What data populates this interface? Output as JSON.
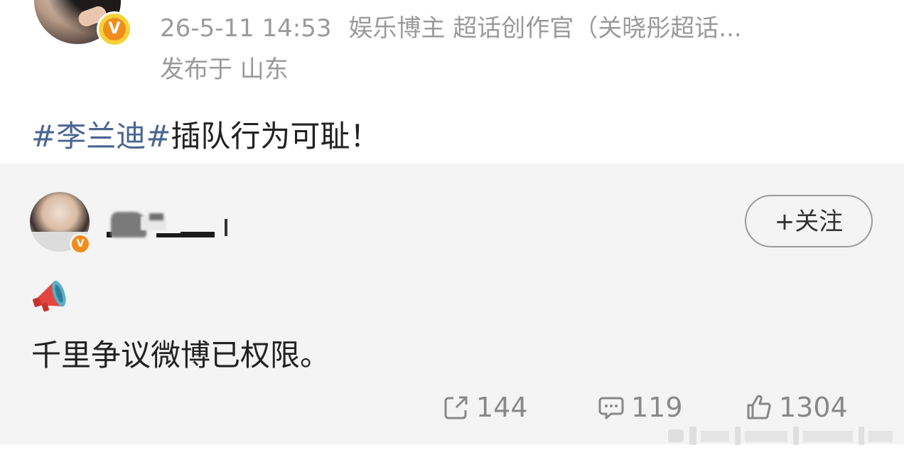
{
  "post": {
    "timestamp": "26-5-11 14:53",
    "author_title": "娱乐博主 超话创作官（关晓彤超话...",
    "location": "发布于 山东",
    "hashtag": "#李兰迪#",
    "text": "插队行为可耻！",
    "verified_label": "V"
  },
  "quoted": {
    "follow_label": "+关注",
    "verified_label": "V",
    "text": "千里争议微博已权限。"
  },
  "actions": {
    "repost_count": "144",
    "comment_count": "119",
    "like_count": "1304"
  },
  "colors": {
    "hashtag": "#4a6591",
    "meta": "#9a9a9a",
    "quoted_bg": "#f4f4f4",
    "verified": "#f08d1c"
  },
  "icons": [
    "megaphone-icon",
    "repost-icon",
    "comment-icon",
    "like-icon",
    "verified-badge-icon"
  ]
}
